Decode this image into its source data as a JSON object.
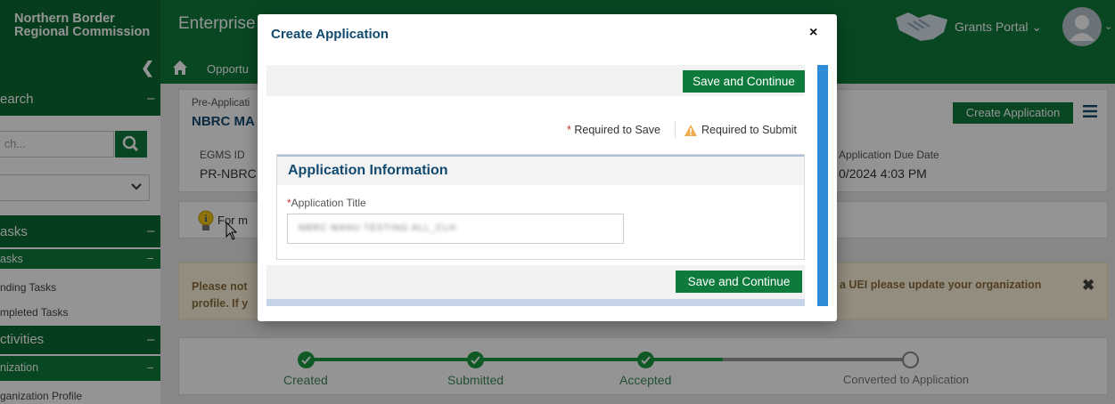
{
  "header": {
    "brand_line1": "Northern Border",
    "brand_line2": "Regional Commission",
    "app_title": "Enterprise",
    "portal_menu": "Grants Portal ⌄",
    "avatar_caret": "⌄"
  },
  "subheader": {
    "tab_label": "Opportu"
  },
  "sidebar": {
    "search_header": "earch",
    "search_placeholder": "ch...",
    "tasks_header": "asks",
    "tasks_sub": "asks",
    "pending_tasks": "nding Tasks",
    "completed_tasks": "mpleted Tasks",
    "activities_header": "ctivities",
    "organization_sub": "nization",
    "organization_profile": "ganization Profile",
    "minus": "–"
  },
  "background": {
    "pre_app_label": "Pre-Applicati",
    "title": "NBRC MA",
    "egms_label": "EGMS ID",
    "egms_value": "PR-NBRC",
    "due_label": "Application Due Date",
    "due_value": "0/2024 4:03 PM",
    "create_button": "Create Application",
    "tip_text": "For m",
    "notice_left_line1": "Please not",
    "notice_left_line2": "profile. If y",
    "notice_right": "a UEI please update your organization",
    "notice_close": "✖"
  },
  "progress": {
    "steps": [
      {
        "label": "Created",
        "done": true
      },
      {
        "label": "Submitted",
        "done": true
      },
      {
        "label": "Accepted",
        "done": true
      },
      {
        "label": "Converted to Application",
        "done": false
      }
    ],
    "colors": {
      "done": "#1a9a3e",
      "pending": "#888888"
    }
  },
  "modal": {
    "title": "Create Application",
    "close": "×",
    "save_continue": "Save and Continue",
    "required_to_save": "Required to Save",
    "required_to_submit": "Required to Submit",
    "section_title": "Application Information",
    "field_label": "Application Title",
    "field_value": "NBRC MANU TESTING ALL_CLH"
  },
  "colors": {
    "brand_green": "#0e7a3c",
    "dark_green": "#0a6a33",
    "title_blue": "#124a6f",
    "scroll_blue": "#2e8cd8",
    "required_red": "#c9302c",
    "warning_orange": "#f0ad4e"
  },
  "icons": [
    "handshake-icon",
    "user-avatar-icon",
    "chevron-left-icon",
    "home-icon",
    "search-icon",
    "chevron-down-icon",
    "lightbulb-icon",
    "menu-icon",
    "close-icon",
    "warning-icon",
    "check-icon",
    "cursor-icon"
  ]
}
